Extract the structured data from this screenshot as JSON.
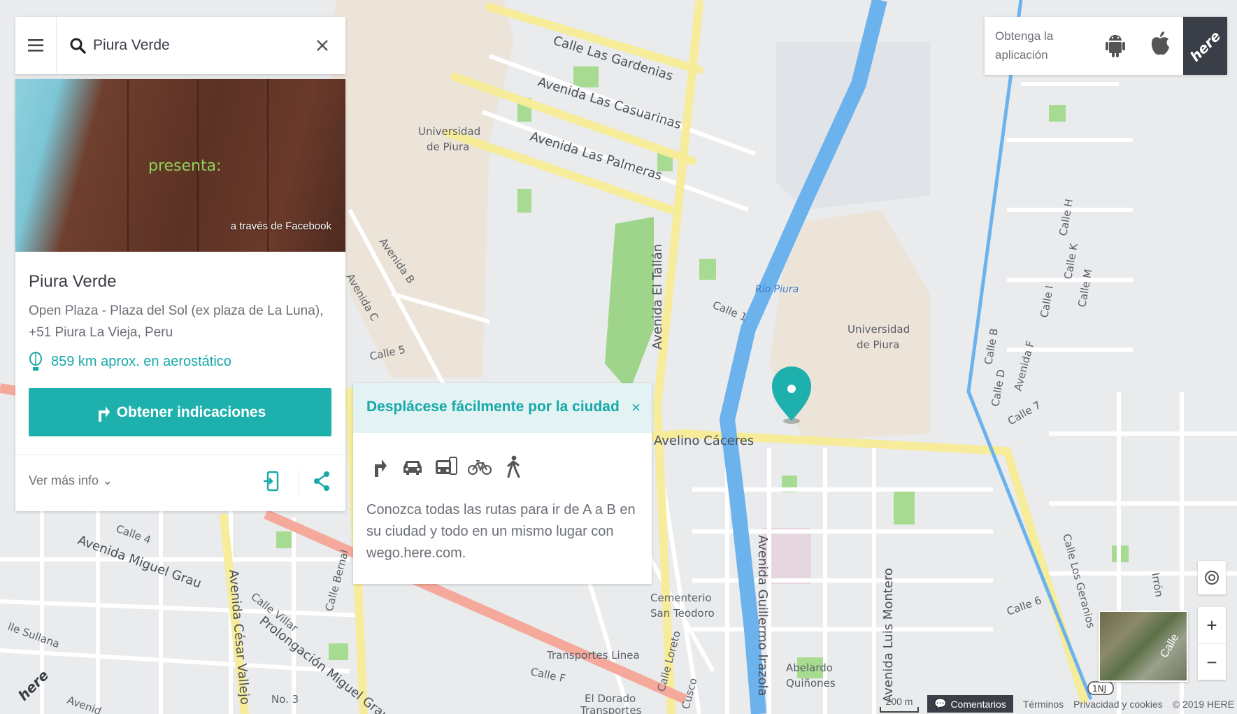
{
  "search": {
    "value": "Piura Verde"
  },
  "place": {
    "photo_caption": "presenta:",
    "photo_source": "a través de Facebook",
    "name": "Piura Verde",
    "address": "Open Plaza - Plaza del Sol (ex plaza de La Luna), +51 Piura La Vieja, Peru",
    "distance": "859 km aprox. en aerostático",
    "directions_label": "Obtener indicaciones",
    "more_info_label": "Ver más info"
  },
  "promo": {
    "title": "Desplácese fácilmente por la ciudad",
    "close_label": "×",
    "text": "Conozca todas las rutas para ir de A a B en su ciudad y todo en un mismo lugar con wego.here.com.",
    "modes": [
      "directions-icon",
      "car-icon",
      "transit-icon",
      "bike-icon",
      "walk-icon"
    ]
  },
  "app_promo": {
    "text": "Obtenga la aplicación",
    "logo": "here"
  },
  "controls": {
    "zoom_in": "+",
    "zoom_out": "−",
    "satellite_label": "Calle"
  },
  "footer": {
    "scale": "200 m",
    "feedback": "Comentarios",
    "terms": "Términos",
    "privacy": "Privacidad y cookies",
    "copyright": "© 2019 HERE"
  },
  "map_labels": {
    "streets": [
      "Calle Las Gardenias",
      "Avenida Las Casuarinas",
      "Avenida Las Palmeras",
      "Avenida El Tallán",
      "Calle 1",
      "Avelino Cáceres",
      "Avenida Guillermo Irazola",
      "Avenida Luis Montero",
      "Calle 4",
      "Avenida Miguel Grau",
      "Calle Villar",
      "Prolongación Miguel Grau",
      "Avenida César Vallejo",
      "Calle Bernal",
      "Avenida B",
      "Calle 5",
      "Calle F",
      "Calle Loreto",
      "Calle Los Geranios",
      "Calle 6",
      "Calle 7",
      "Calle B",
      "Calle D",
      "Avenida F",
      "Calle I",
      "Calle K",
      "Calle M",
      "Calle H",
      "Calle Sullana",
      "No. 3",
      "Avenida C",
      "Cusco",
      "Irrón"
    ],
    "places": [
      "Universidad de Piura",
      "Universidad de Piura",
      "Cementerio San Teodoro",
      "Transportes Linea",
      "El Dorado Transportes",
      "Abelardo Quiñones"
    ],
    "river": "Río Piura",
    "route_badge": "1NJ"
  },
  "colors": {
    "accent": "#1eb0ad",
    "river": "#6cb2ec",
    "main_road": "#f6ec9a",
    "rail": "#f4a99b"
  }
}
